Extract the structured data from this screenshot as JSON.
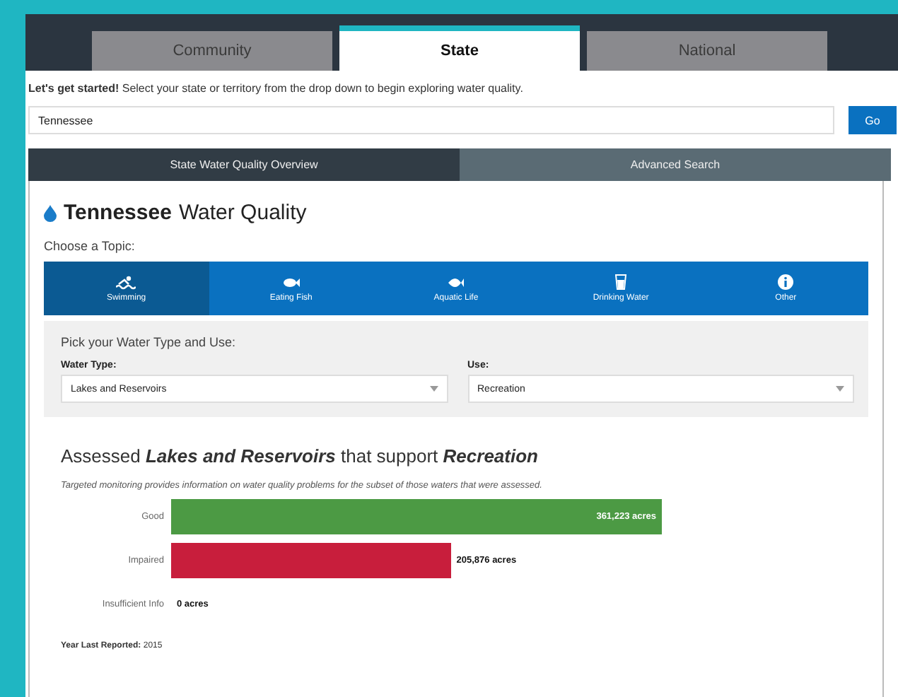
{
  "main_tabs": [
    {
      "label": "Community",
      "selected": false
    },
    {
      "label": "State",
      "selected": true
    },
    {
      "label": "National",
      "selected": false
    }
  ],
  "intro": "**Let's get started!** Select your state or territory from the drop down to begin exploring water quality.",
  "state_select": {
    "value": "Tennessee"
  },
  "go_button": "Go",
  "sub_tabs": [
    {
      "label": "State Water Quality Overview",
      "selected": true
    },
    {
      "label": "Advanced Search",
      "selected": false
    }
  ],
  "title_state": "Tennessee",
  "title_rest": "Water Quality",
  "topic_prompt": "Choose a Topic:",
  "topics": [
    {
      "label": "Swimming",
      "kind": "swim",
      "selected": true
    },
    {
      "label": "Eating Fish",
      "kind": "fish",
      "selected": false
    },
    {
      "label": "Aquatic Life",
      "kind": "aquatic",
      "selected": false
    },
    {
      "label": "Drinking Water",
      "kind": "drink",
      "selected": false
    },
    {
      "label": "Other",
      "kind": "info",
      "selected": false
    }
  ],
  "filter_prompt": "Pick your Water Type and Use:",
  "water_type": {
    "label": "Water Type:",
    "value": "Lakes and Reservoirs"
  },
  "use": {
    "label": "Use:",
    "value": "Recreation"
  },
  "heading": "Assessed **Lakes and Reservoirs** that support **Recreation**",
  "note": "Targeted monitoring provides information on water quality problems for the subset of those waters that were assessed.",
  "results": [
    {
      "label": "Good",
      "kind": "good",
      "value": "361,223 acres"
    },
    {
      "label": "Impaired",
      "kind": "impaired",
      "value": "205,876 acres"
    },
    {
      "label": "Insufficient Info",
      "kind": "insufficient",
      "value": "0 acres"
    }
  ],
  "year_label": "Year Last Reported:",
  "year": "2015"
}
